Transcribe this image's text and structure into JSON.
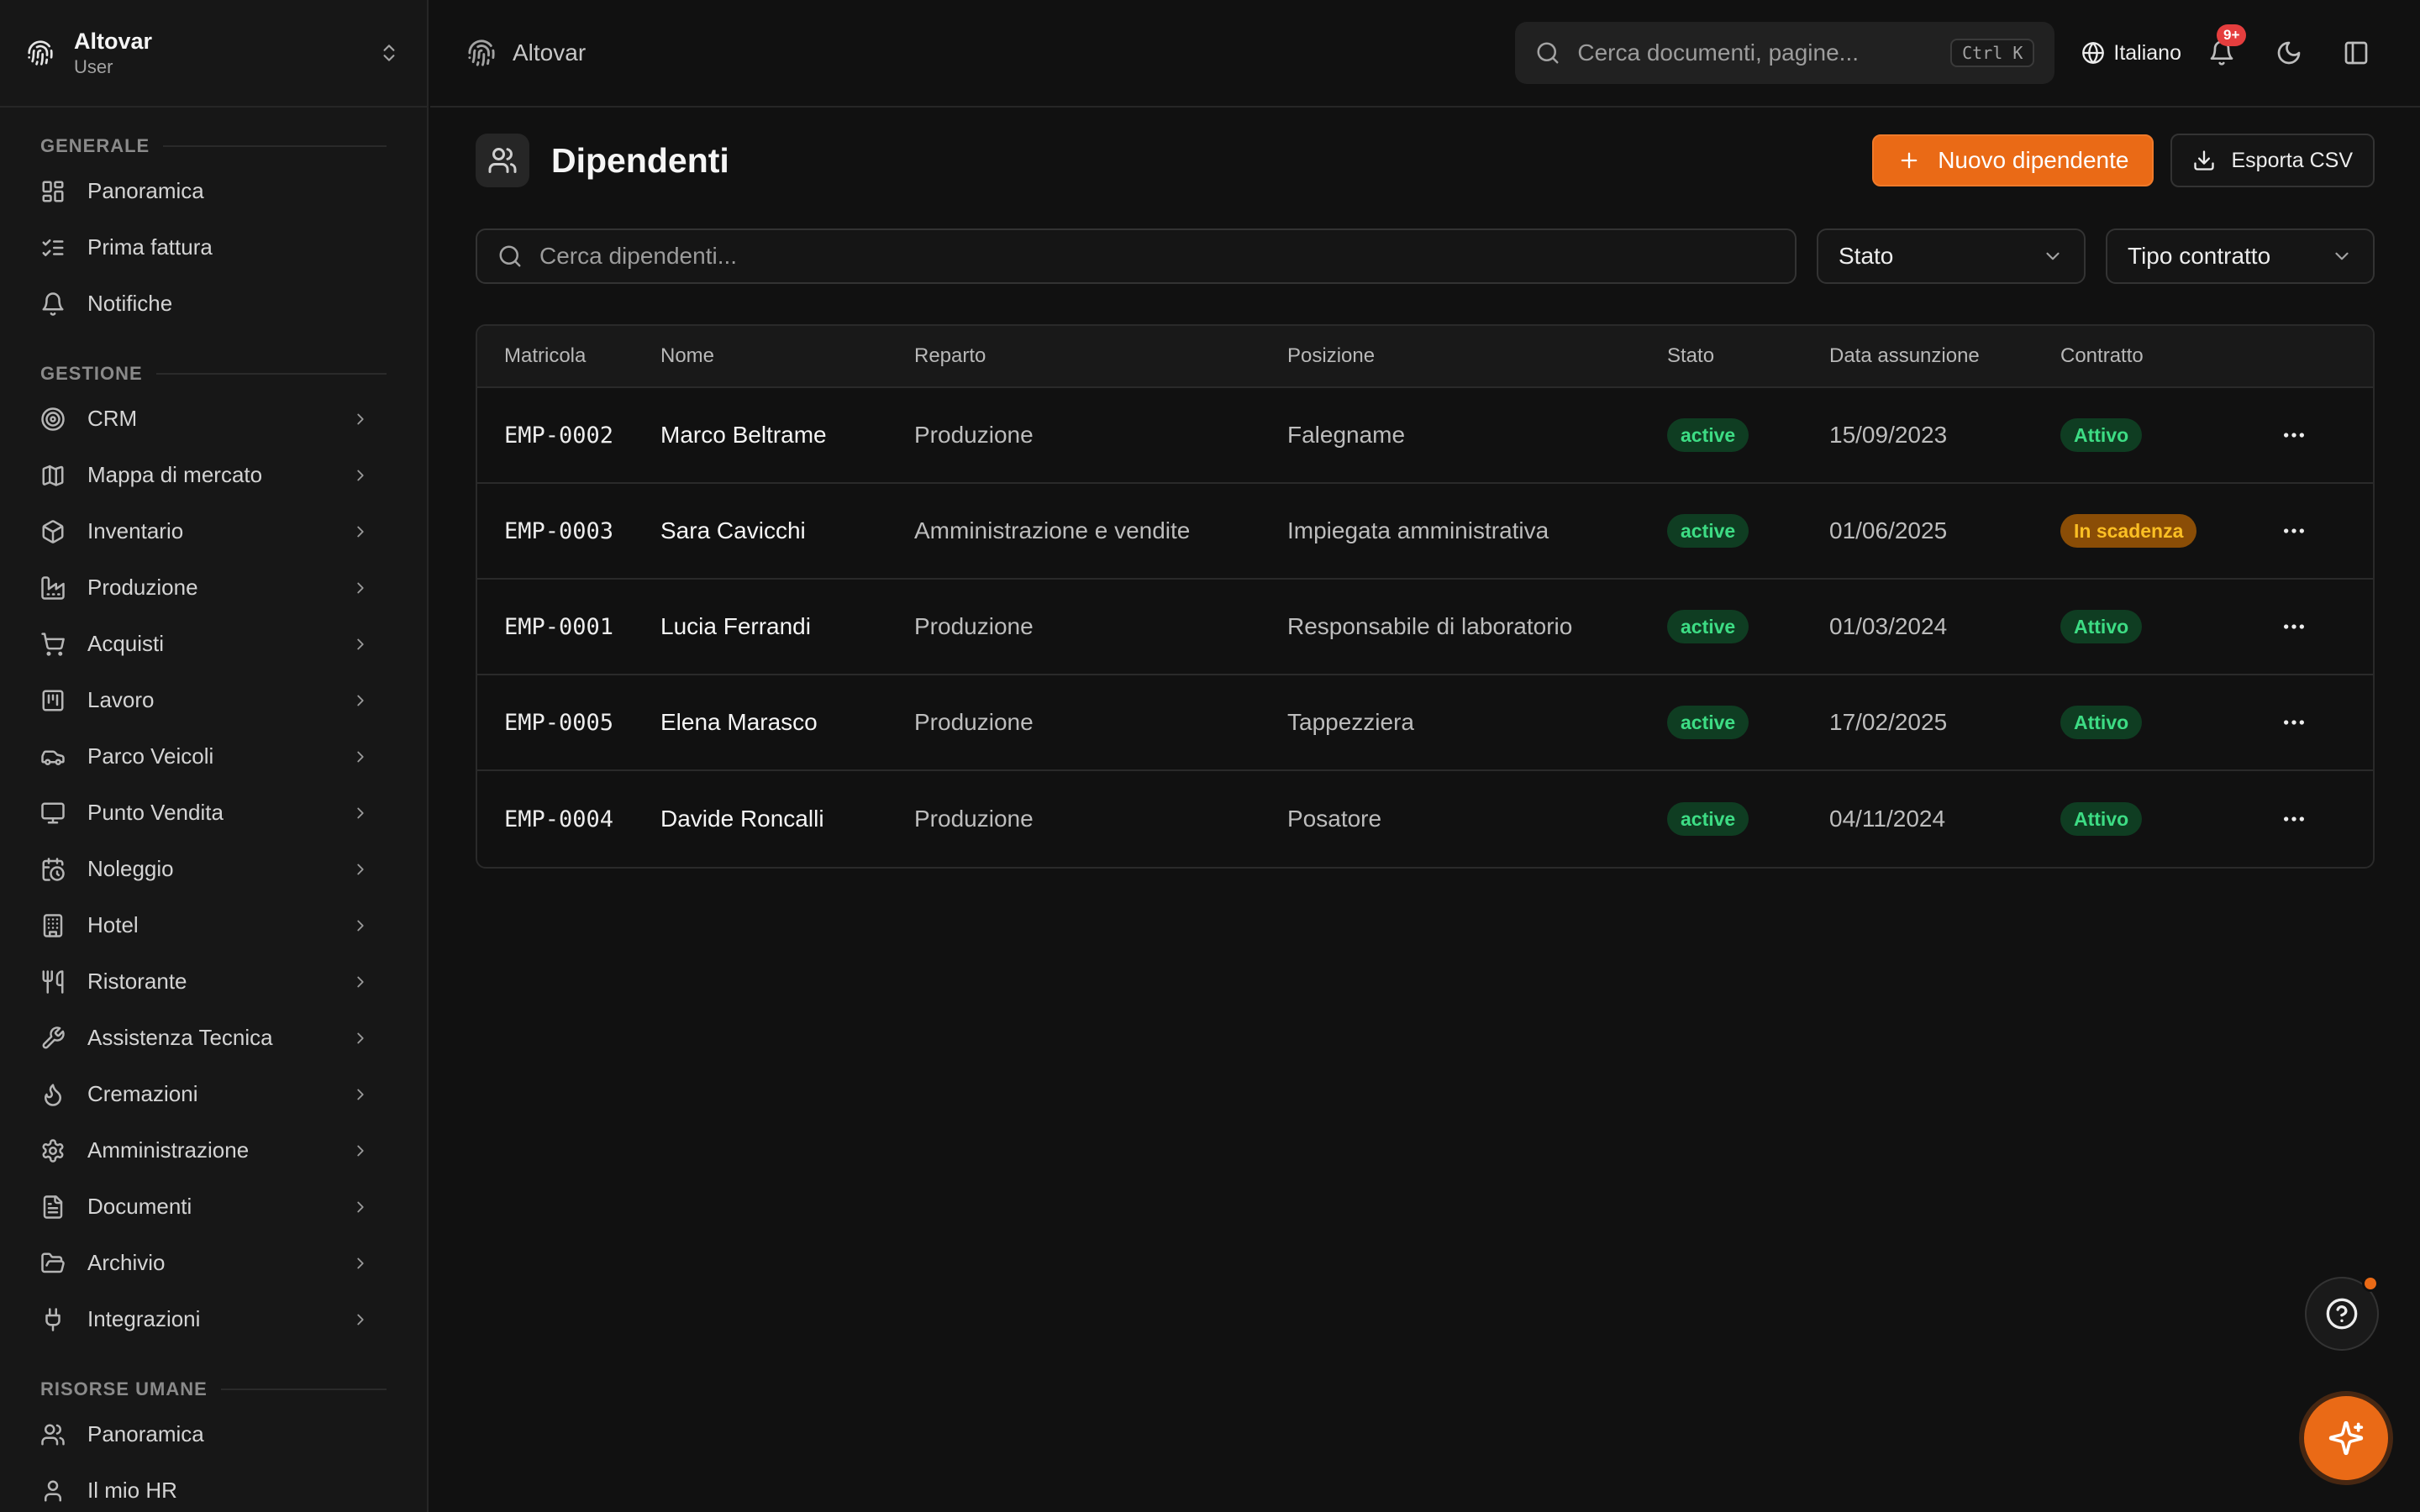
{
  "org": {
    "name": "Altovar",
    "role": "User"
  },
  "topbar": {
    "breadcrumb": "Altovar",
    "search_placeholder": "Cerca documenti, pagine...",
    "search_shortcut": "Ctrl K",
    "language": "Italiano",
    "notifications_count": "9+"
  },
  "sidebar": {
    "sections": [
      {
        "title": "GENERALE",
        "items": [
          {
            "label": "Panoramica",
            "icon": "dashboard-icon",
            "chevron": false
          },
          {
            "label": "Prima fattura",
            "icon": "checklist-icon",
            "chevron": false
          },
          {
            "label": "Notifiche",
            "icon": "bell-icon",
            "chevron": false
          }
        ]
      },
      {
        "title": "GESTIONE",
        "items": [
          {
            "label": "CRM",
            "icon": "target-icon",
            "chevron": true
          },
          {
            "label": "Mappa di mercato",
            "icon": "map-icon",
            "chevron": true
          },
          {
            "label": "Inventario",
            "icon": "package-icon",
            "chevron": true
          },
          {
            "label": "Produzione",
            "icon": "factory-icon",
            "chevron": true
          },
          {
            "label": "Acquisti",
            "icon": "cart-icon",
            "chevron": true
          },
          {
            "label": "Lavoro",
            "icon": "kanban-icon",
            "chevron": true
          },
          {
            "label": "Parco Veicoli",
            "icon": "car-icon",
            "chevron": true
          },
          {
            "label": "Punto Vendita",
            "icon": "monitor-icon",
            "chevron": true
          },
          {
            "label": "Noleggio",
            "icon": "calendar-clock-icon",
            "chevron": true
          },
          {
            "label": "Hotel",
            "icon": "building-icon",
            "chevron": true
          },
          {
            "label": "Ristorante",
            "icon": "utensils-icon",
            "chevron": true
          },
          {
            "label": "Assistenza Tecnica",
            "icon": "wrench-icon",
            "chevron": true
          },
          {
            "label": "Cremazioni",
            "icon": "flame-icon",
            "chevron": true
          },
          {
            "label": "Amministrazione",
            "icon": "gear-icon",
            "chevron": true
          },
          {
            "label": "Documenti",
            "icon": "file-text-icon",
            "chevron": true
          },
          {
            "label": "Archivio",
            "icon": "folder-open-icon",
            "chevron": true
          },
          {
            "label": "Integrazioni",
            "icon": "plug-icon",
            "chevron": true
          }
        ]
      },
      {
        "title": "RISORSE UMANE",
        "items": [
          {
            "label": "Panoramica",
            "icon": "users-icon",
            "chevron": false
          },
          {
            "label": "Il mio HR",
            "icon": "user-icon",
            "chevron": false
          }
        ]
      }
    ]
  },
  "page": {
    "title": "Dipendenti",
    "new_button": "Nuovo dipendente",
    "export_button": "Esporta CSV",
    "search_placeholder": "Cerca dipendenti...",
    "filter_status": "Stato",
    "filter_contract": "Tipo contratto"
  },
  "table": {
    "columns": [
      "Matricola",
      "Nome",
      "Reparto",
      "Posizione",
      "Stato",
      "Data assunzione",
      "Contratto"
    ],
    "rows": [
      {
        "id": "EMP-0002",
        "name": "Marco Beltrame",
        "department": "Produzione",
        "position": "Falegname",
        "status": "active",
        "hired": "15/09/2023",
        "contract": "Attivo",
        "contract_tone": "green"
      },
      {
        "id": "EMP-0003",
        "name": "Sara Cavicchi",
        "department": "Amministrazione e vendite",
        "position": "Impiegata amministrativa",
        "status": "active",
        "hired": "01/06/2025",
        "contract": "In scadenza",
        "contract_tone": "amber"
      },
      {
        "id": "EMP-0001",
        "name": "Lucia Ferrandi",
        "department": "Produzione",
        "position": "Responsabile di laboratorio",
        "status": "active",
        "hired": "01/03/2024",
        "contract": "Attivo",
        "contract_tone": "green"
      },
      {
        "id": "EMP-0005",
        "name": "Elena Marasco",
        "department": "Produzione",
        "position": "Tappezziera",
        "status": "active",
        "hired": "17/02/2025",
        "contract": "Attivo",
        "contract_tone": "green"
      },
      {
        "id": "EMP-0004",
        "name": "Davide Roncalli",
        "department": "Produzione",
        "position": "Posatore",
        "status": "active",
        "hired": "04/11/2024",
        "contract": "Attivo",
        "contract_tone": "green"
      }
    ]
  },
  "colors": {
    "accent": "#ea6a16",
    "success": "#3ddc84",
    "warning": "#fbbf24",
    "danger": "#e53e3e"
  }
}
